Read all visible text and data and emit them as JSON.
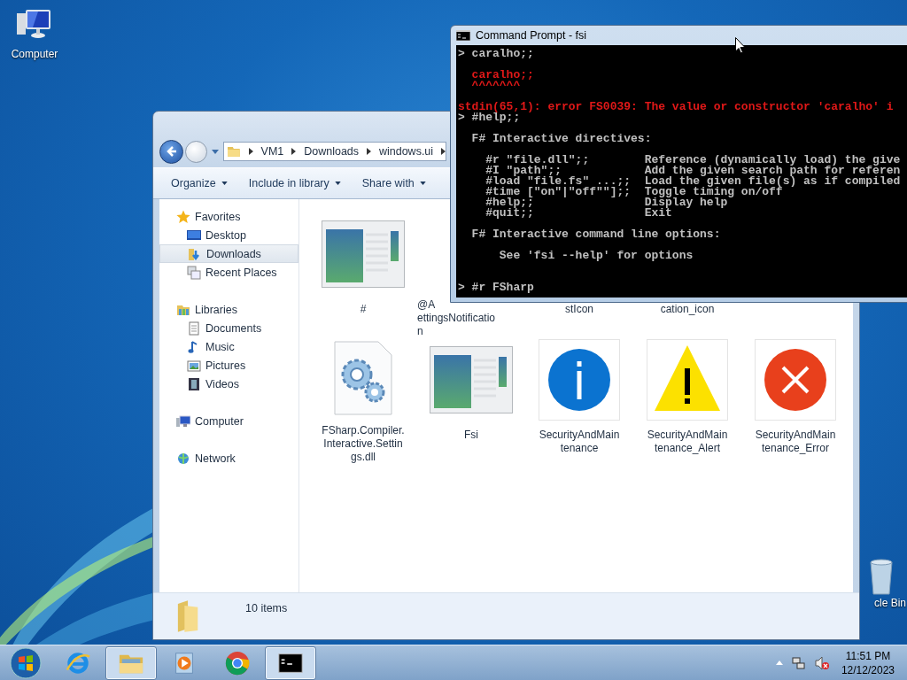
{
  "desktop_icons": [
    {
      "label": "Computer",
      "kind": "computer"
    },
    {
      "label": "cle Bin",
      "kind": "recycle-bin"
    }
  ],
  "explorer": {
    "breadcrumbs": [
      "VM1",
      "Downloads",
      "windows.ui"
    ],
    "toolbar": [
      "Organize",
      "Include in library",
      "Share with"
    ],
    "sidebar": [
      {
        "label": "Favorites",
        "kind": "favorites",
        "selected": false,
        "children": [
          {
            "label": "Desktop",
            "kind": "desktop",
            "selected": false
          },
          {
            "label": "Downloads",
            "kind": "downloads",
            "selected": true
          },
          {
            "label": "Recent Places",
            "kind": "recent",
            "selected": false
          }
        ]
      },
      {
        "label": "Libraries",
        "kind": "libraries",
        "selected": false,
        "children": [
          {
            "label": "Documents",
            "kind": "documents",
            "selected": false
          },
          {
            "label": "Music",
            "kind": "music",
            "selected": false
          },
          {
            "label": "Pictures",
            "kind": "pictures",
            "selected": false
          },
          {
            "label": "Videos",
            "kind": "videos",
            "selected": false
          }
        ]
      },
      {
        "label": "Computer",
        "kind": "computer",
        "selected": false
      },
      {
        "label": "Network",
        "kind": "network",
        "selected": false
      }
    ],
    "file_rows": [
      [
        {
          "kind": "thumbnail",
          "lines": [
            "#"
          ]
        },
        {
          "kind": "covered",
          "clipped": true,
          "lines": [
            "@A",
            "ettingsNotificatio",
            "n"
          ]
        },
        {
          "kind": "covered",
          "lines": [
            "stIcon"
          ]
        },
        {
          "kind": "covered",
          "lines": [
            "cation_icon"
          ]
        }
      ],
      [
        {
          "kind": "settings-file",
          "lines": [
            "FSharp.Compiler.",
            "Interactive.Settin",
            "gs.dll"
          ]
        },
        {
          "kind": "thumbnail",
          "lines": [
            "Fsi"
          ]
        },
        {
          "kind": "info",
          "lines": [
            "SecurityAndMain",
            "tenance"
          ]
        },
        {
          "kind": "warning",
          "lines": [
            "SecurityAndMain",
            "tenance_Alert"
          ]
        },
        {
          "kind": "error",
          "lines": [
            "SecurityAndMain",
            "tenance_Error"
          ]
        }
      ]
    ],
    "status": "10 items"
  },
  "console": {
    "title": "Command Prompt - fsi",
    "lines": [
      {
        "kind": "input",
        "text": "> caralho;;"
      },
      {
        "kind": "blank"
      },
      {
        "kind": "error",
        "text": "  caralho;;"
      },
      {
        "kind": "error",
        "text": "  ^^^^^^^"
      },
      {
        "kind": "blank"
      },
      {
        "kind": "error",
        "text": "stdin(65,1): error FS0039: The value or constructor 'caralho' i"
      },
      {
        "kind": "input",
        "text": "> #help;;"
      },
      {
        "kind": "blank"
      },
      {
        "kind": "output",
        "text": "  F# Interactive directives:"
      },
      {
        "kind": "blank"
      },
      {
        "kind": "output",
        "text": "    #r \"file.dll\";;        Reference (dynamically load) the give"
      },
      {
        "kind": "output",
        "text": "    #I \"path\";;            Add the given search path for referen"
      },
      {
        "kind": "output",
        "text": "    #load \"file.fs\" ...;;  Load the given file(s) as if compiled"
      },
      {
        "kind": "output",
        "text": "    #time [\"on\"|\"off\"\"];;  Toggle timing on/off"
      },
      {
        "kind": "output",
        "text": "    #help;;                Display help"
      },
      {
        "kind": "output",
        "text": "    #quit;;                Exit"
      },
      {
        "kind": "blank"
      },
      {
        "kind": "output",
        "text": "  F# Interactive command line options:"
      },
      {
        "kind": "blank"
      },
      {
        "kind": "output",
        "text": "      See 'fsi --help' for options"
      },
      {
        "kind": "blank"
      },
      {
        "kind": "blank"
      },
      {
        "kind": "input",
        "text": "> #r FSharp"
      }
    ]
  },
  "taskbar": {
    "items": [
      {
        "kind": "start"
      },
      {
        "kind": "browser-e",
        "open": false
      },
      {
        "kind": "explorer",
        "open": true
      },
      {
        "kind": "media",
        "open": false
      },
      {
        "kind": "chrome",
        "open": false
      },
      {
        "kind": "console",
        "open": true
      }
    ],
    "time": "11:51 PM",
    "date": "12/12/2023"
  }
}
